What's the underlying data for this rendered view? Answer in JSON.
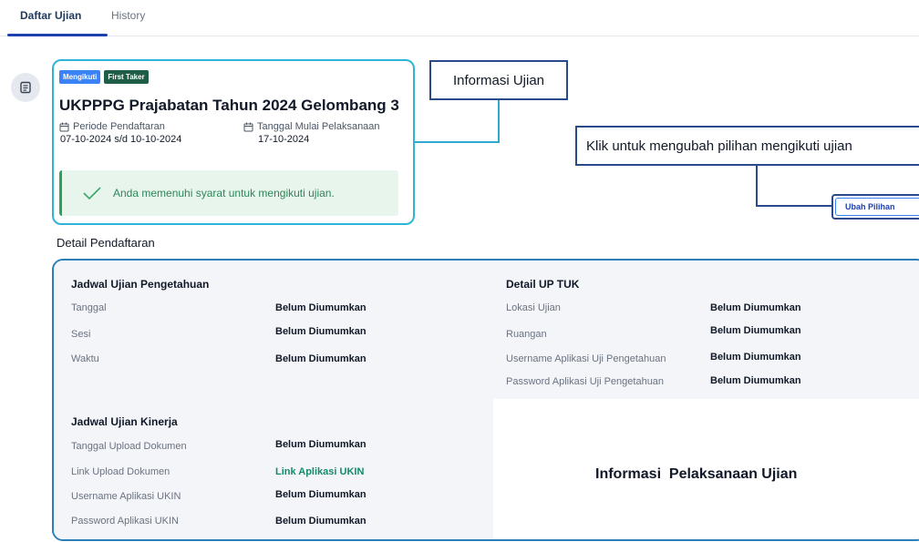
{
  "tabs": {
    "active": "Daftar Ujian",
    "inactive": "History"
  },
  "exam": {
    "badges": [
      "Mengikuti",
      "First Taker"
    ],
    "title": "UKPPPG Prajabatan Tahun 2024 Gelombang 3",
    "registration_period_label": "Periode Pendaftaran",
    "registration_period_value": "07-10-2024 s/d 10-10-2024",
    "start_date_label": "Tanggal Mulai Pelaksanaan",
    "start_date_value": "17-10-2024",
    "eligibility_message": "Anda memenuhi syarat untuk mengikuti ujian."
  },
  "callouts": {
    "info_ujian": "Informasi Ujian",
    "klik": "Klik untuk mengubah pilihan mengikuti ujian",
    "pelaksanaan": "Informasi  Pelaksanaan Ujian"
  },
  "change_button": "Ubah Pilihan",
  "detail": {
    "section_title": "Detail Pendaftaran",
    "jadwal_pengetahuan": {
      "title": "Jadwal Ujian Pengetahuan",
      "rows": [
        {
          "label": "Tanggal",
          "value": "Belum Diumumkan"
        },
        {
          "label": "Sesi",
          "value": "Belum Diumumkan"
        },
        {
          "label": "Waktu",
          "value": "Belum Diumumkan"
        }
      ]
    },
    "up_tuk": {
      "title": "Detail UP TUK",
      "rows": [
        {
          "label": "Lokasi Ujian",
          "value": "Belum Diumumkan"
        },
        {
          "label": "Ruangan",
          "value": "Belum Diumumkan"
        },
        {
          "label": "Username Aplikasi Uji Pengetahuan",
          "value": "Belum Diumumkan"
        },
        {
          "label": "Password Aplikasi Uji Pengetahuan",
          "value": "Belum Diumumkan"
        }
      ]
    },
    "jadwal_kinerja": {
      "title": "Jadwal Ujian Kinerja",
      "rows": [
        {
          "label": "Tanggal Upload Dokumen",
          "value": "Belum Diumumkan"
        },
        {
          "label": "Link Upload Dokumen",
          "value": "Link Aplikasi UKIN"
        },
        {
          "label": "Username Aplikasi UKIN",
          "value": "Belum Diumumkan"
        },
        {
          "label": "Password Aplikasi UKIN",
          "value": "Belum Diumumkan"
        }
      ]
    }
  },
  "colors": {
    "accent": "#2fb4d6",
    "callout_border": "#2b4a8c",
    "success_bg": "#e7f5ec",
    "success_text": "#2f855a",
    "badge_mengikuti": "#3b82f6",
    "badge_first_taker": "#1e5e47",
    "link": "#138a6a"
  }
}
